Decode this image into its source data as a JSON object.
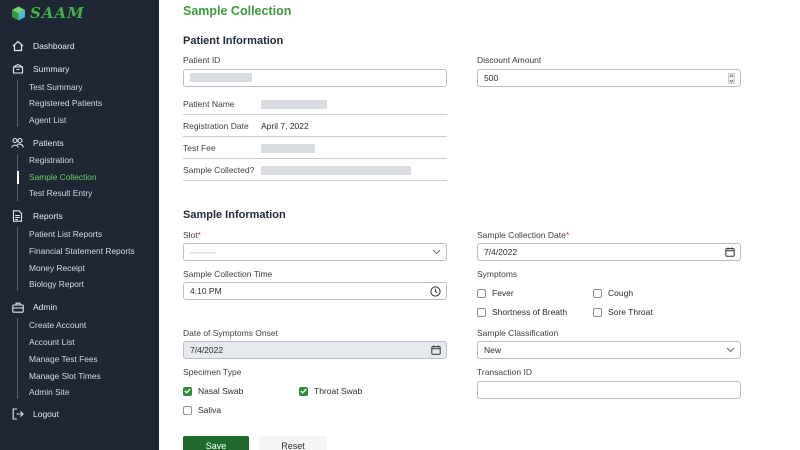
{
  "app": {
    "logo_text": "SAAM"
  },
  "sidebar": {
    "dashboard": "Dashboard",
    "summary": {
      "label": "Summary",
      "items": [
        "Test Summary",
        "Registered Patients",
        "Agent List"
      ]
    },
    "patients": {
      "label": "Patients",
      "items": [
        "Registration",
        "Sample Collection",
        "Test Result Entry"
      ],
      "active": "Sample Collection"
    },
    "reports": {
      "label": "Reports",
      "items": [
        "Patient List Reports",
        "Financial Statement Reports",
        "Money Receipt",
        "Biology Report"
      ]
    },
    "admin": {
      "label": "Admin",
      "items": [
        "Create Account",
        "Account List",
        "Manage Test Fees",
        "Manage Slot Times",
        "Admin Site"
      ]
    },
    "logout": "Logout"
  },
  "page": {
    "title": "Sample Collection"
  },
  "patient_info": {
    "title": "Patient Information",
    "patient_id_label": "Patient ID",
    "discount_label": "Discount Amount",
    "discount_value": "500",
    "name_label": "Patient Name",
    "reg_date_label": "Registration Date",
    "reg_date_value": "April 7, 2022",
    "fee_label": "Test Fee",
    "collected_label": "Sample Collected?"
  },
  "sample_info": {
    "title": "Sample Information",
    "slot_label": "Slot",
    "required_mark": "*",
    "slot_value": "---------",
    "date_label": "Sample Collection Date",
    "date_value": "7/4/2022",
    "time_label": "Sample Collection Time",
    "time_value": "4:10 PM",
    "symptoms_label": "Symptoms",
    "symptoms": [
      {
        "label": "Fever",
        "checked": false
      },
      {
        "label": "Cough",
        "checked": false
      },
      {
        "label": "Shortness of Breath",
        "checked": false
      },
      {
        "label": "Sore Throat",
        "checked": false
      }
    ],
    "onset_label": "Date of Symptoms Onset",
    "onset_value": "7/4/2022",
    "classification_label": "Sample Classification",
    "classification_value": "New",
    "specimen_label": "Specimen Type",
    "specimens": [
      {
        "label": "Nasal Swab",
        "checked": true
      },
      {
        "label": "Throat Swab",
        "checked": true
      },
      {
        "label": "Saliva",
        "checked": false
      }
    ],
    "transaction_label": "Transaction ID",
    "transaction_value": ""
  },
  "actions": {
    "save": "Save",
    "reset": "Reset"
  },
  "colors": {
    "sidebar_bg": "#1e2733",
    "accent_green": "#3e9a3a",
    "save_bg": "#1f6b2e",
    "active_nav": "#6ecf6d"
  }
}
